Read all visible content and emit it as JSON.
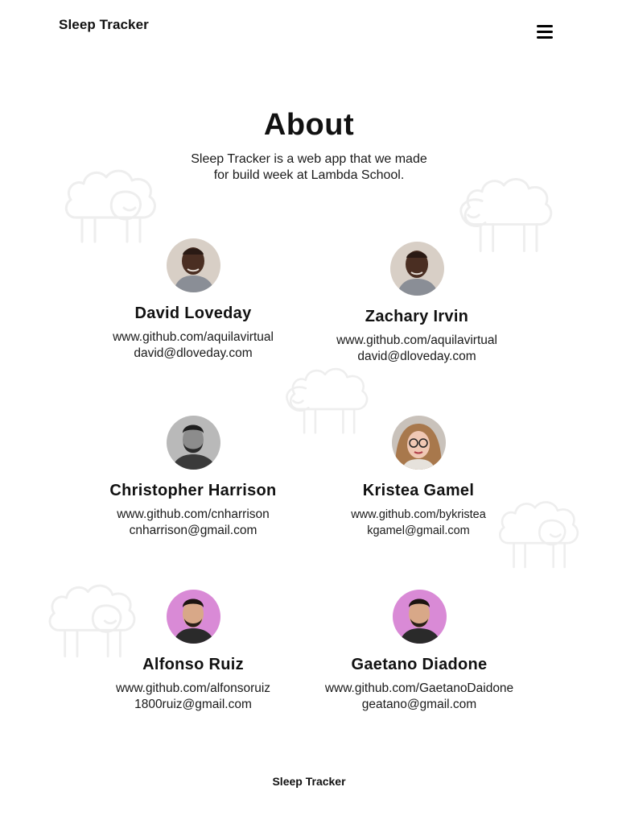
{
  "header": {
    "brand": "Sleep Tracker",
    "menu_icon": "hamburger-icon"
  },
  "about": {
    "title": "About",
    "description": "Sleep Tracker is a web app that we made for build week at Lambda School."
  },
  "team": [
    {
      "name": "David Loveday",
      "github": "www.github.com/aquilavirtual",
      "email": "david@dloveday.com"
    },
    {
      "name": "Zachary Irvin",
      "github": "www.github.com/aquilavirtual",
      "email": "david@dloveday.com"
    },
    {
      "name": "Christopher Harrison",
      "github": "www.github.com/cnharrison",
      "email": "cnharrison@gmail.com"
    },
    {
      "name": "Kristea Gamel",
      "github": "www.github.com/bykristea",
      "email": "kgamel@gmail.com"
    },
    {
      "name": "Alfonso Ruiz",
      "github": "www.github.com/alfonsoruiz",
      "email": "1800ruiz@gmail.com"
    },
    {
      "name": "Gaetano Diadone",
      "github": "www.github.com/GaetanoDaidone",
      "email": "geatano@gmail.com"
    }
  ],
  "background_icon": "sheep-icon",
  "footer": {
    "brand": "Sleep Tracker"
  }
}
